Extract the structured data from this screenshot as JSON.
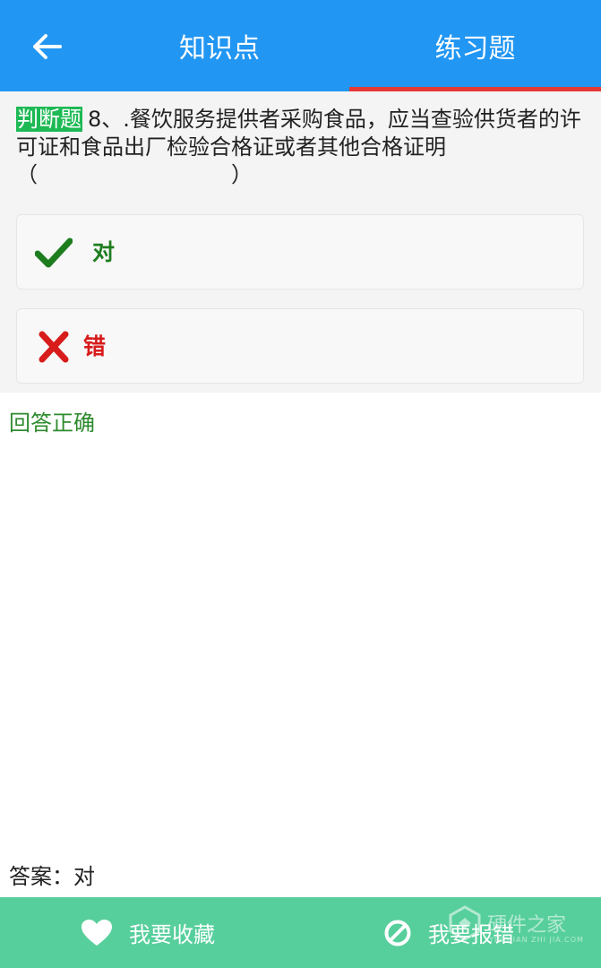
{
  "header": {
    "tab_knowledge": "知识点",
    "tab_exercise": "练习题",
    "active_tab": "练习题"
  },
  "question": {
    "type_label": "判断题",
    "text": "8、.餐饮服务提供者采购食品，应当查验供货者的许可证和食品出厂检验合格证或者其他合格证明（　　　　　　　　　）"
  },
  "options": {
    "true_label": "对",
    "false_label": "错"
  },
  "result": "回答正确",
  "answer": "答案：对",
  "bottom_bar": {
    "favorite_label": "我要收藏",
    "report_label": "我要报错"
  },
  "watermark": {
    "text": "硬件之家",
    "subtext": "YINGJIAN ZHI JIA.COM"
  },
  "colors": {
    "header": "#2196f3",
    "tab_indicator": "#e53935",
    "correct": "#1e7d1e",
    "wrong": "#d81b1b",
    "bottom_bar": "#57cf9c"
  },
  "icons": [
    "back-arrow-icon",
    "check-icon",
    "cross-icon",
    "heart-icon",
    "prohibit-icon"
  ]
}
